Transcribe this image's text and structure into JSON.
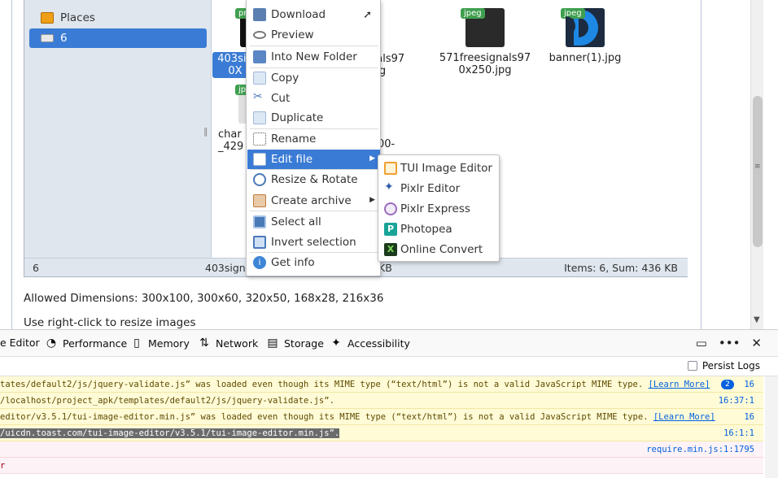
{
  "navbar": {
    "places_label": "Places",
    "current_label": "6"
  },
  "files": [
    {
      "badge": "png",
      "name_line1": "403sig",
      "name_line2": "0X"
    },
    {
      "name_line1": "nals97",
      "name_line2": "jpg"
    },
    {
      "badge": "jpeg",
      "name_line1": "571freesignals97",
      "name_line2": "0x250.jpg"
    },
    {
      "badge": "jpeg",
      "name_line1": "banner(1).jpg"
    },
    {
      "badge": "jpe",
      "name_line1": "char",
      "name_line2": "_429",
      "tail": "00-"
    }
  ],
  "statusbar": {
    "left": "6",
    "middle": "403sign",
    "middle_tail": "KB",
    "right": "Items: 6, Sum: 436 KB"
  },
  "page_text": {
    "allowed": "Allowed Dimensions: 300x100, 300x60, 320x50, 168x28, 216x36",
    "hint": "Use right-click to resize images"
  },
  "context_menu": {
    "items": [
      {
        "label": "Download",
        "icon": "download-icon",
        "color": "#5a7fb0"
      },
      {
        "label": "Preview",
        "icon": "eye-icon",
        "color": "#777777"
      },
      {
        "label": "Into New Folder",
        "icon": "folder-icon",
        "color": "#5a86c5"
      },
      {
        "label": "Copy",
        "icon": "copy-icon",
        "color": "#9fb8d8"
      },
      {
        "label": "Cut",
        "icon": "scissors-icon",
        "color": "#4a7ab8"
      },
      {
        "label": "Duplicate",
        "icon": "duplicate-icon",
        "color": "#9fb8d8"
      },
      {
        "label": "Rename",
        "icon": "rename-icon",
        "color": "#555555"
      },
      {
        "label": "Edit file",
        "icon": "edit-file-icon",
        "color": "#ffffff"
      },
      {
        "label": "Resize & Rotate",
        "icon": "resize-icon",
        "color": "#4a7ab8"
      },
      {
        "label": "Create archive",
        "icon": "archive-icon",
        "color": "#c07a3a"
      },
      {
        "label": "Select all",
        "icon": "select-all-icon",
        "color": "#4a7ab8"
      },
      {
        "label": "Invert selection",
        "icon": "invert-selection-icon",
        "color": "#4a7ab8"
      },
      {
        "label": "Get info",
        "icon": "info-icon",
        "color": "#3d85d6"
      }
    ]
  },
  "submenu": {
    "items": [
      {
        "label": "TUI Image Editor",
        "icon": "tui-icon",
        "color": "#f0a030"
      },
      {
        "label": "Pixlr Editor",
        "icon": "pixlr-editor-icon",
        "color": "#2d5fa6"
      },
      {
        "label": "Pixlr Express",
        "icon": "pixlr-express-icon",
        "color": "#9a6bc0"
      },
      {
        "label": "Photopea",
        "icon": "photopea-icon",
        "color": "#18a497"
      },
      {
        "label": "Online Convert",
        "icon": "online-convert-icon",
        "color": "#2e7d32"
      }
    ]
  },
  "devtools": {
    "tabs": [
      {
        "label": "e Editor",
        "icon": ""
      },
      {
        "label": "Performance",
        "icon": "performance-icon"
      },
      {
        "label": "Memory",
        "icon": "memory-icon"
      },
      {
        "label": "Network",
        "icon": "network-icon"
      },
      {
        "label": "Storage",
        "icon": "storage-icon"
      },
      {
        "label": "Accessibility",
        "icon": "accessibility-icon"
      }
    ],
    "persist_logs": "Persist Logs",
    "logs": [
      {
        "type": "warn",
        "text": "tates/default2/js/jquery-validate.js” was loaded even though its MIME type (“text/html”) is not a valid JavaScript MIME type. ",
        "link": "[Learn More]",
        "count": "2",
        "src": "16"
      },
      {
        "type": "warn",
        "text": "/localhost/project_apk/templates/default2/js/jquery-validate.js”.",
        "src": "16:37:1"
      },
      {
        "type": "warn",
        "text": "editor/v3.5.1/tui-image-editor.min.js” was loaded even though its MIME type (“text/html”) is not a valid JavaScript MIME type. ",
        "link": "[Learn More]",
        "src": "16"
      },
      {
        "type": "warn",
        "highlight": "/uicdn.toast.com/tui-image-editor/v3.5.1/tui-image-editor.min.js”.",
        "src": "16:1:1"
      },
      {
        "type": "err",
        "text": "",
        "src": "require.min.js:1:1795"
      },
      {
        "type": "err",
        "text": "r",
        "src": ""
      }
    ]
  }
}
